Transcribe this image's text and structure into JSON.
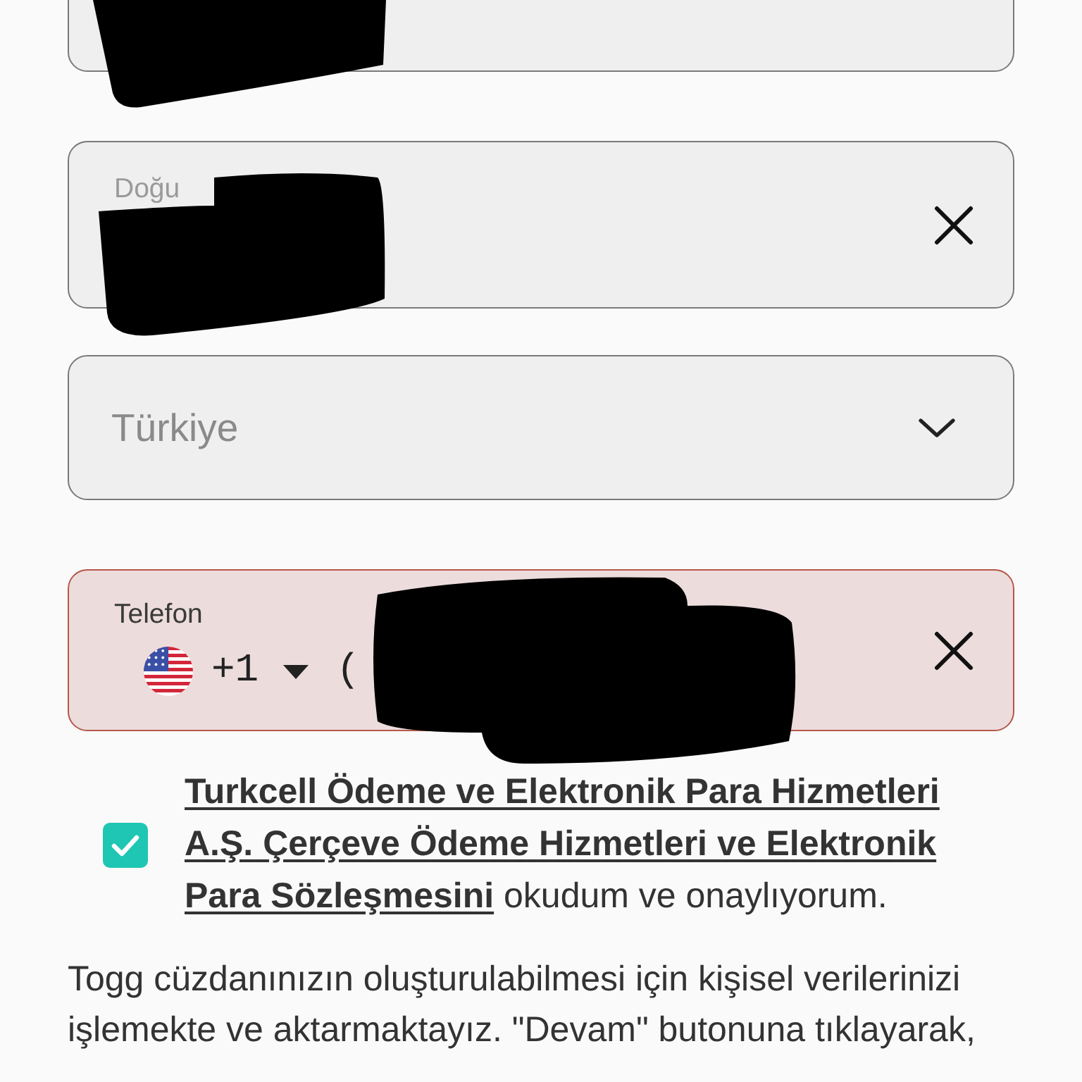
{
  "form": {
    "fields": [
      {
        "kind": "text",
        "clearable": false
      },
      {
        "kind": "text",
        "label": "Doğu",
        "clearable": true
      },
      {
        "kind": "select",
        "value": "Türkiye"
      },
      {
        "kind": "phone",
        "label": "Telefon",
        "dial_code": "+1",
        "value": "(",
        "clearable": true,
        "error": true
      }
    ]
  },
  "consent": {
    "checked": true,
    "text": "**Turkcell Ödeme ve Elektronik Para Hizmetleri A.Ş. Çerçeve Ödeme Hizmetleri ve Elektronik Para Sözleşmesini** okudum ve onaylıyorum."
  },
  "notice": "Togg cüzdanınızın oluşturulabilmesi için kişisel verilerinizi işlemekte ve aktarmaktayız. \"Devam\" butonuna tıklayarak,"
}
